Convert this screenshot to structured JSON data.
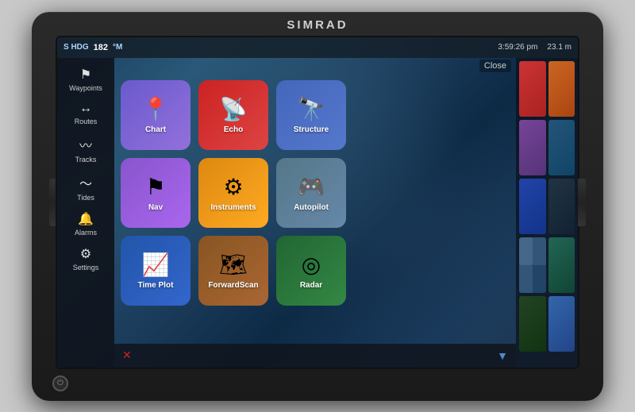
{
  "device": {
    "brand": "SIMRAD"
  },
  "topbar": {
    "hdg_label": "S HDG",
    "hdg_value": "182",
    "hdg_unit": "°M",
    "time": "3:59:26 pm",
    "distance": "23.1 m",
    "close_label": "Close"
  },
  "sidebar": {
    "items": [
      {
        "id": "waypoints",
        "label": "Waypoints",
        "icon": "⚑"
      },
      {
        "id": "routes",
        "label": "Routes",
        "icon": "↔"
      },
      {
        "id": "tracks",
        "label": "Tracks",
        "icon": "〰"
      },
      {
        "id": "tides",
        "label": "Tides",
        "icon": "〜"
      },
      {
        "id": "alarms",
        "label": "Alarms",
        "icon": "🔔"
      },
      {
        "id": "settings",
        "label": "Settings",
        "icon": "⚙"
      }
    ]
  },
  "apps": [
    {
      "id": "chart",
      "label": "Chart",
      "tileClass": "tile-chart",
      "icon": "📍"
    },
    {
      "id": "echo",
      "label": "Echo",
      "tileClass": "tile-echo",
      "icon": "📡"
    },
    {
      "id": "structure",
      "label": "Structure",
      "tileClass": "tile-structure",
      "icon": "🔭"
    },
    {
      "id": "nav",
      "label": "Nav",
      "tileClass": "tile-nav",
      "icon": "⚑"
    },
    {
      "id": "instruments",
      "label": "Instruments",
      "tileClass": "tile-instruments",
      "icon": "⚙"
    },
    {
      "id": "autopilot",
      "label": "Autopilot",
      "tileClass": "tile-autopilot",
      "icon": "🎮"
    },
    {
      "id": "timeplot",
      "label": "Time Plot",
      "tileClass": "tile-timeplot",
      "icon": "📈"
    },
    {
      "id": "forwardscan",
      "label": "ForwardScan",
      "tileClass": "tile-forwardscan",
      "icon": "🗺"
    },
    {
      "id": "radar",
      "label": "Radar",
      "tileClass": "tile-radar",
      "icon": "◎"
    }
  ],
  "bottom": {
    "delete_icon": "✕",
    "nav_arrow": "▼"
  }
}
